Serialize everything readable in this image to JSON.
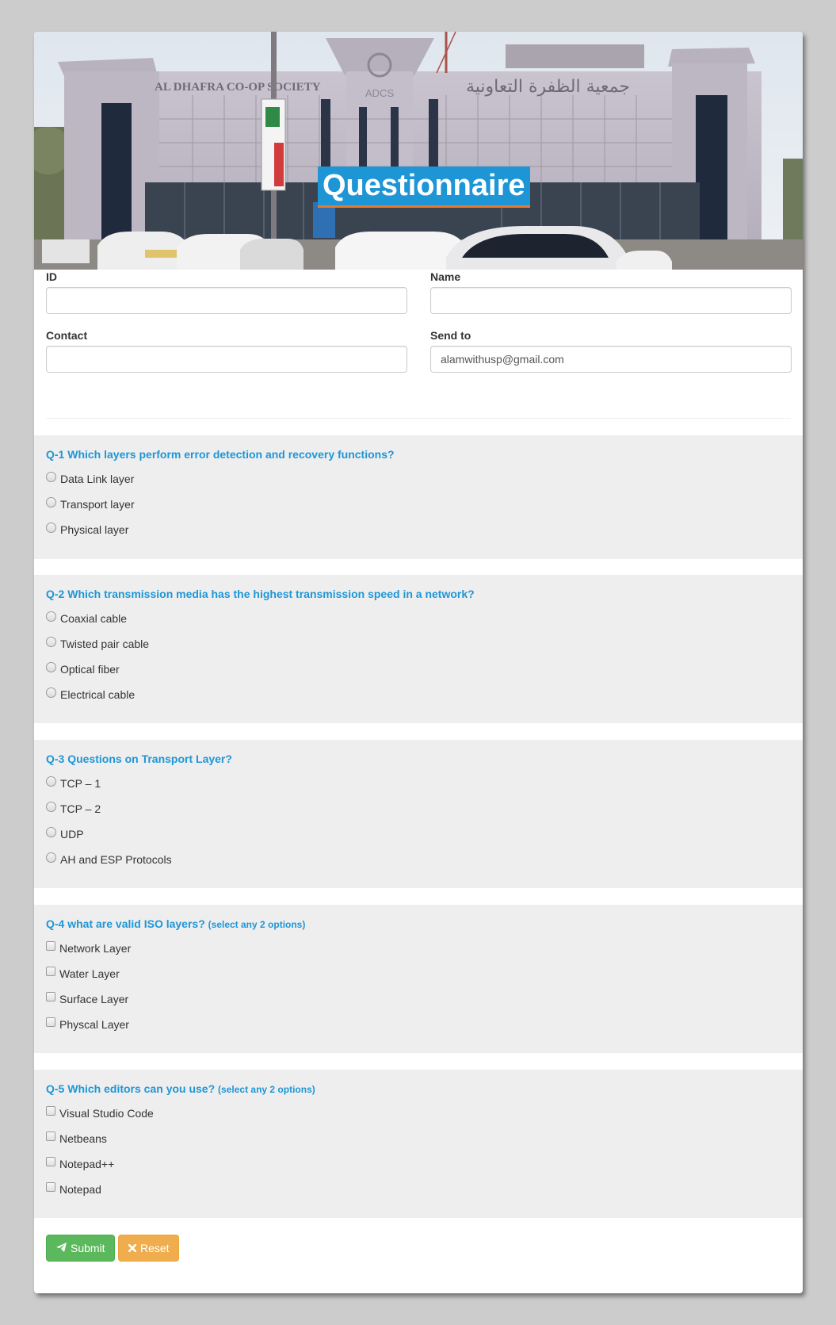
{
  "banner": {
    "title": "Questionnaire",
    "sign_left": "AL DHAFRA CO-OP SOCIETY",
    "sign_right": "جمعية الظفرة التعاونية",
    "logo_text": "ADCS"
  },
  "form": {
    "id": {
      "label": "ID",
      "value": "",
      "placeholder": ""
    },
    "name": {
      "label": "Name",
      "value": "",
      "placeholder": ""
    },
    "contact": {
      "label": "Contact",
      "value": "",
      "placeholder": ""
    },
    "send_to": {
      "label": "Send to",
      "value": "alamwithusp@gmail.com",
      "placeholder": ""
    }
  },
  "questions": [
    {
      "title": "Q-1 Which layers perform error detection and recovery functions?",
      "hint": "",
      "type": "radio",
      "options": [
        "Data Link layer",
        "Transport layer",
        "Physical layer"
      ]
    },
    {
      "title": "Q-2 Which transmission media has the highest transmission speed in a network?",
      "hint": "",
      "type": "radio",
      "options": [
        "Coaxial cable",
        "Twisted pair cable",
        "Optical fiber",
        "Electrical cable"
      ]
    },
    {
      "title": "Q-3 Questions on Transport Layer?",
      "hint": "",
      "type": "radio",
      "options": [
        "TCP – 1",
        "TCP – 2",
        "UDP",
        "AH and ESP Protocols"
      ]
    },
    {
      "title": "Q-4 what are valid ISO layers?",
      "hint": "(select any 2 options)",
      "type": "checkbox",
      "options": [
        "Network Layer",
        "Water Layer",
        "Surface Layer",
        "Physcal Layer"
      ]
    },
    {
      "title": "Q-5 Which editors can you use?",
      "hint": "(select any 2 options)",
      "type": "checkbox",
      "options": [
        "Visual Studio Code",
        "Netbeans",
        "Notepad++",
        "Notepad"
      ]
    }
  ],
  "buttons": {
    "submit": {
      "label": "Submit",
      "icon": "paper-plane-icon"
    },
    "reset": {
      "label": "Reset",
      "icon": "times-icon"
    }
  },
  "colors": {
    "page_bg": "#cccccc",
    "accent": "#1e96d6",
    "title_underline": "#e8792c",
    "question_bg": "#eeeeee",
    "submit": "#5cb85c",
    "reset": "#f0ad4e"
  }
}
